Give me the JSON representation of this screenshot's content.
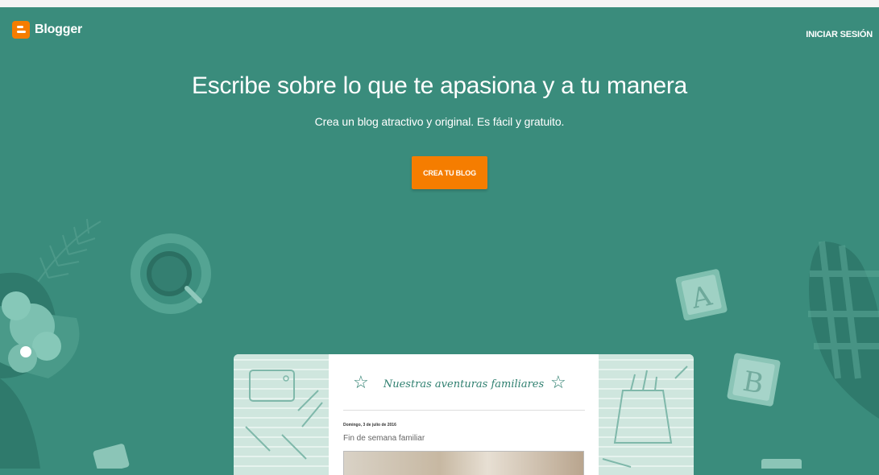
{
  "header": {
    "brand_name": "Blogger",
    "signin_label": "INICIAR SESIÓN"
  },
  "hero": {
    "title": "Escribe sobre lo que te apasiona y a tu manera",
    "subtitle": "Crea un blog atractivo y original. Es fácil y gratuito.",
    "cta_label": "CREA TU BLOG"
  },
  "mockup": {
    "blog_title": "Nuestras aventuras familiares",
    "post_date": "Domingo, 3 de julio de 2016",
    "post_title": "Fin de semana familiar"
  },
  "decor": {
    "block_a_letter": "A",
    "block_b_letter": "B"
  },
  "colors": {
    "background": "#3a8c7c",
    "accent": "#f57d00",
    "mockup_green": "#2e7f6f"
  }
}
